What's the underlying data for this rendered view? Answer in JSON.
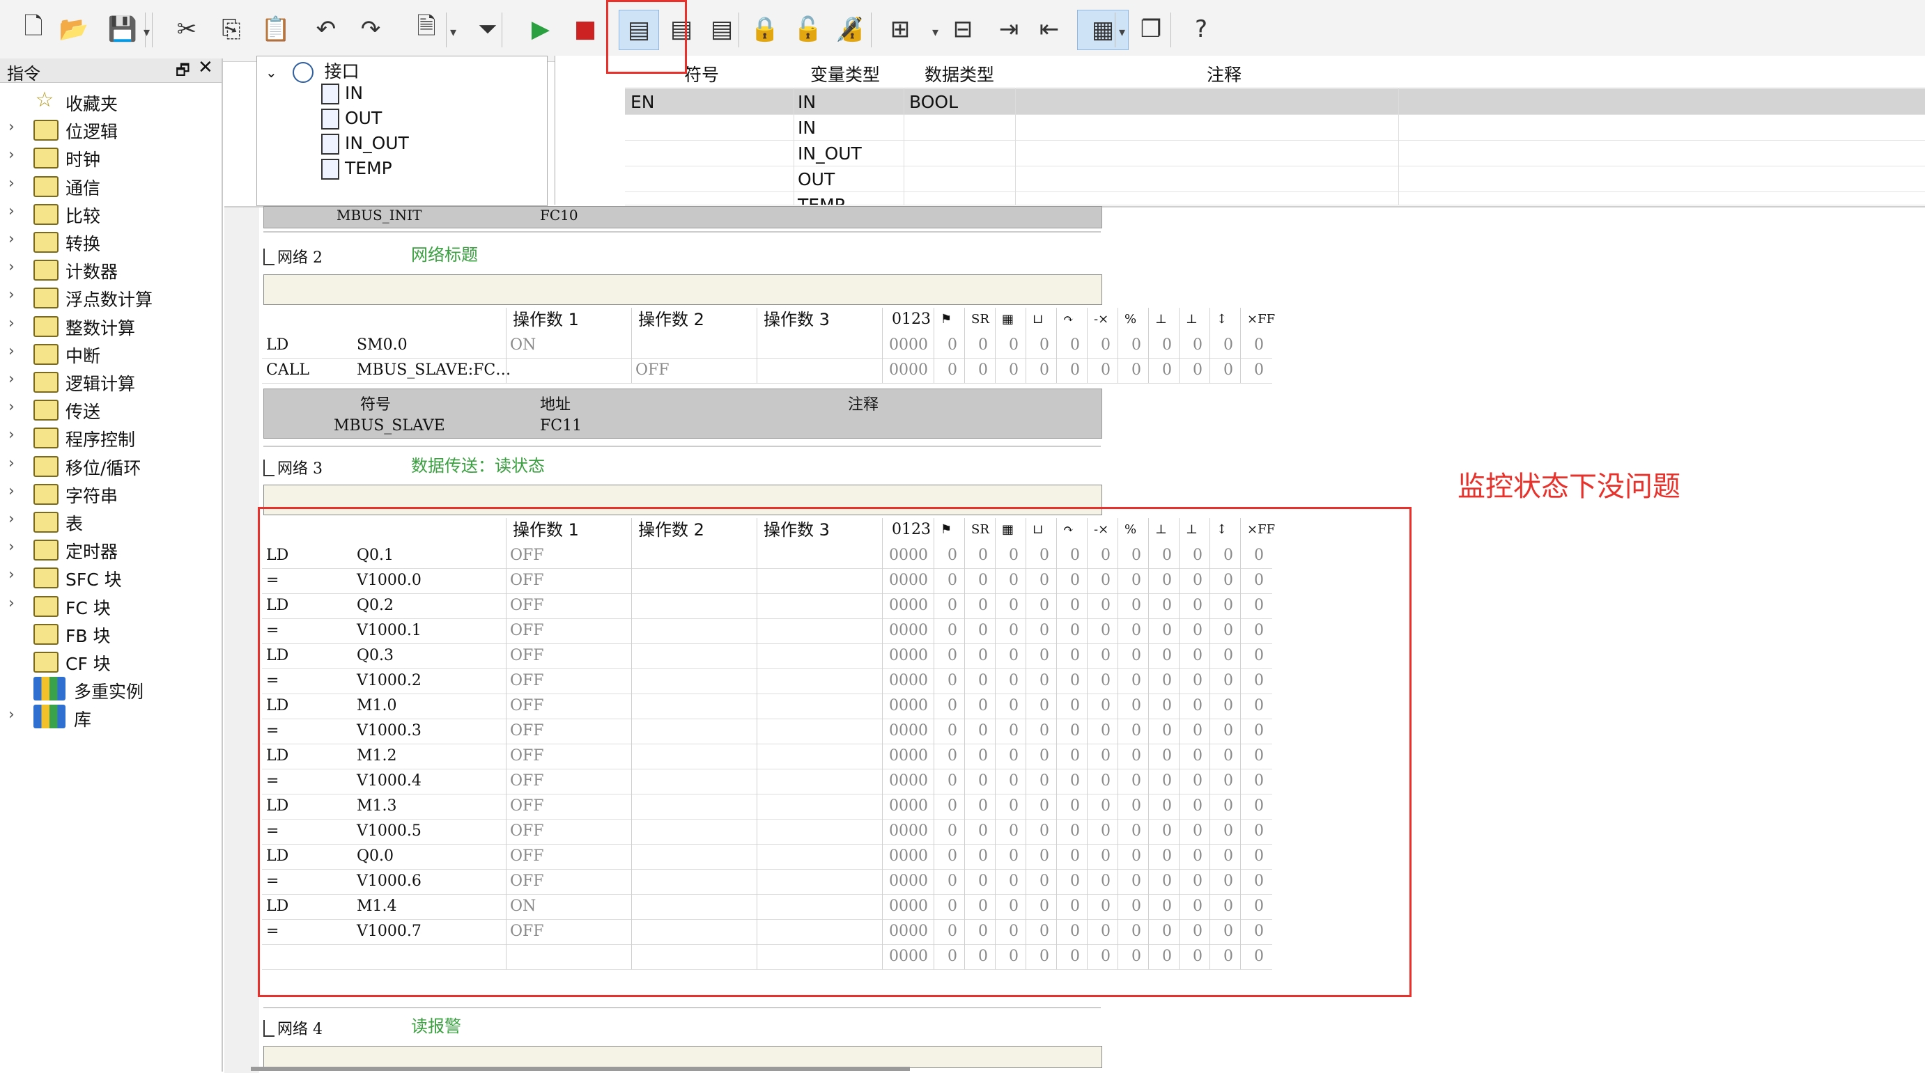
{
  "toolbar": {
    "icons": [
      "new-file-icon",
      "open-folder-icon",
      "save-icon",
      "cut-icon",
      "copy-icon",
      "paste-icon",
      "undo-icon",
      "redo-icon",
      "page-icon",
      "download-icon",
      "run-icon",
      "stop-icon",
      "program-status-icon",
      "table-status-icon",
      "trend-status-icon",
      "lock-icon",
      "unlock-icon",
      "force-icon",
      "insert-network-icon",
      "delete-network-icon",
      "indent-icon",
      "outdent-icon",
      "table-view-icon",
      "window-icon",
      "help-icon"
    ],
    "colors": {
      "run": "#2aa040",
      "stop": "#cc2222",
      "highlight": "#e8312b"
    }
  },
  "left_panel": {
    "title": "指令",
    "float_glyph": "🗗",
    "close_glyph": "✕",
    "items": [
      {
        "label": "收藏夹",
        "icon": "star-icon",
        "chev": false
      },
      {
        "label": "位逻辑",
        "icon": "folder-icon",
        "chev": true
      },
      {
        "label": "时钟",
        "icon": "folder-icon",
        "chev": true
      },
      {
        "label": "通信",
        "icon": "folder-icon",
        "chev": true
      },
      {
        "label": "比较",
        "icon": "folder-icon",
        "chev": true
      },
      {
        "label": "转换",
        "icon": "folder-icon",
        "chev": true
      },
      {
        "label": "计数器",
        "icon": "folder-icon",
        "chev": true
      },
      {
        "label": "浮点数计算",
        "icon": "folder-icon",
        "chev": true
      },
      {
        "label": "整数计算",
        "icon": "folder-icon",
        "chev": true
      },
      {
        "label": "中断",
        "icon": "folder-icon",
        "chev": true
      },
      {
        "label": "逻辑计算",
        "icon": "folder-icon",
        "chev": true
      },
      {
        "label": "传送",
        "icon": "folder-icon",
        "chev": true
      },
      {
        "label": "程序控制",
        "icon": "folder-icon",
        "chev": true
      },
      {
        "label": "移位/循环",
        "icon": "folder-icon",
        "chev": true
      },
      {
        "label": "字符串",
        "icon": "folder-icon",
        "chev": true
      },
      {
        "label": "表",
        "icon": "folder-icon",
        "chev": true
      },
      {
        "label": "定时器",
        "icon": "folder-icon",
        "chev": true
      },
      {
        "label": "SFC 块",
        "icon": "folder-icon",
        "chev": true
      },
      {
        "label": "FC 块",
        "icon": "folder-icon",
        "chev": true
      },
      {
        "label": "FB 块",
        "icon": "folder-icon",
        "chev": false
      },
      {
        "label": "CF 块",
        "icon": "folder-icon",
        "chev": false
      },
      {
        "label": "多重实例",
        "icon": "books-icon",
        "chev": false
      },
      {
        "label": "库",
        "icon": "books-icon",
        "chev": true
      }
    ]
  },
  "interface_tree": {
    "root": "接口",
    "children": [
      "IN",
      "OUT",
      "IN_OUT",
      "TEMP"
    ]
  },
  "interface_table": {
    "headers": [
      "符号",
      "变量类型",
      "数据类型",
      "注释"
    ],
    "rows": [
      {
        "symbol": "EN",
        "var_type": "IN",
        "data_type": "BOOL",
        "comment": ""
      },
      {
        "symbol": "",
        "var_type": "IN",
        "data_type": "",
        "comment": ""
      },
      {
        "symbol": "",
        "var_type": "IN_OUT",
        "data_type": "",
        "comment": ""
      },
      {
        "symbol": "",
        "var_type": "OUT",
        "data_type": "",
        "comment": ""
      },
      {
        "symbol": "",
        "var_type": "TEMP",
        "data_type": "",
        "comment": ""
      }
    ]
  },
  "editor": {
    "top_partial": {
      "symbol": "MBUS_INIT",
      "address": "FC10"
    },
    "grid_headers": {
      "op1": "操作数 1",
      "op2": "操作数 2",
      "op3": "操作数 3",
      "status": "0123",
      "flags": [
        "⚑",
        "SR",
        "▦",
        "⊔",
        "↷",
        "-×",
        "%",
        "⊥",
        "⊥",
        "↕",
        "×FF"
      ]
    },
    "network2": {
      "title": "网络 2",
      "comment": "网络标题",
      "rows": [
        {
          "op": "LD",
          "arg": "SM0.0",
          "v1": "ON",
          "v2": "",
          "v3": "",
          "status": "0000"
        },
        {
          "op": "CALL",
          "arg": "MBUS_SLAVE:FC…",
          "v1": "",
          "v2": "OFF",
          "v3": "",
          "status": "0000"
        }
      ],
      "symtab": {
        "headers": [
          "符号",
          "地址",
          "注释"
        ],
        "row": {
          "symbol": "MBUS_SLAVE",
          "address": "FC11",
          "comment": ""
        }
      }
    },
    "network3": {
      "title": "网络 3",
      "comment": "数据传送：读状态",
      "rows": [
        {
          "op": "LD",
          "arg": "Q0.1",
          "v1": "OFF",
          "status": "0000"
        },
        {
          "op": "=",
          "arg": "V1000.0",
          "v1": "OFF",
          "status": "0000"
        },
        {
          "op": "LD",
          "arg": "Q0.2",
          "v1": "OFF",
          "status": "0000"
        },
        {
          "op": "=",
          "arg": "V1000.1",
          "v1": "OFF",
          "status": "0000"
        },
        {
          "op": "LD",
          "arg": "Q0.3",
          "v1": "OFF",
          "status": "0000"
        },
        {
          "op": "=",
          "arg": "V1000.2",
          "v1": "OFF",
          "status": "0000"
        },
        {
          "op": "LD",
          "arg": "M1.0",
          "v1": "OFF",
          "status": "0000"
        },
        {
          "op": "=",
          "arg": "V1000.3",
          "v1": "OFF",
          "status": "0000"
        },
        {
          "op": "LD",
          "arg": "M1.2",
          "v1": "OFF",
          "status": "0000"
        },
        {
          "op": "=",
          "arg": "V1000.4",
          "v1": "OFF",
          "status": "0000"
        },
        {
          "op": "LD",
          "arg": "M1.3",
          "v1": "OFF",
          "status": "0000"
        },
        {
          "op": "=",
          "arg": "V1000.5",
          "v1": "OFF",
          "status": "0000"
        },
        {
          "op": "LD",
          "arg": "Q0.0",
          "v1": "OFF",
          "status": "0000"
        },
        {
          "op": "=",
          "arg": "V1000.6",
          "v1": "OFF",
          "status": "0000"
        },
        {
          "op": "LD",
          "arg": "M1.4",
          "v1": "ON",
          "status": "0000"
        },
        {
          "op": "=",
          "arg": "V1000.7",
          "v1": "OFF",
          "status": "0000"
        },
        {
          "op": "",
          "arg": "",
          "v1": "",
          "status": "0000"
        }
      ]
    },
    "network4": {
      "title": "网络 4",
      "comment": "读报警"
    },
    "flag_value": "0"
  },
  "annotation": "监控状态下没问题"
}
